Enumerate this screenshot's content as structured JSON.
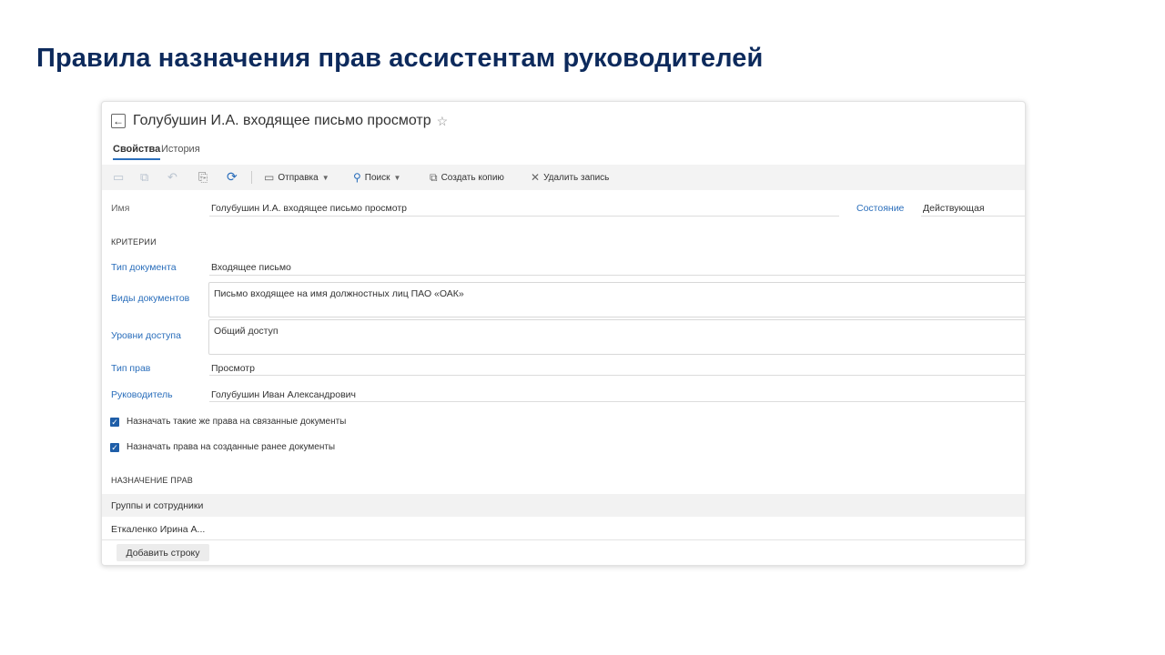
{
  "slide": {
    "title": "Правила назначения прав ассистентам руководителей"
  },
  "record": {
    "title": "Голубушин И.А. входящее письмо просмотр",
    "tabs": [
      {
        "label": "Свойства"
      },
      {
        "label": "История"
      }
    ]
  },
  "toolbar": {
    "send_label": "Отправка",
    "search_label": "Поиск",
    "copy_label": "Создать копию",
    "delete_label": "Удалить запись"
  },
  "form": {
    "name_label": "Имя",
    "name_value": "Голубушин И.А. входящее письмо просмотр",
    "state_label": "Состояние",
    "state_value": "Действующая",
    "criteria_section": "КРИТЕРИИ",
    "doc_type_label": "Тип документа",
    "doc_type_value": "Входящее письмо",
    "doc_kinds_label": "Виды документов",
    "doc_kinds_value": "Письмо входящее на имя должностных лиц ПАО «ОАК»",
    "access_levels_label": "Уровни доступа",
    "access_levels_value": "Общий доступ",
    "rights_type_label": "Тип прав",
    "rights_type_value": "Просмотр",
    "manager_label": "Руководитель",
    "manager_value": "Голубушин Иван Александрович",
    "checkbox_related_label": "Назначать такие же права на связанные документы",
    "checkbox_related_checked": true,
    "checkbox_existing_label": "Назначать права на созданные ранее документы",
    "checkbox_existing_checked": true,
    "assignment_section": "НАЗНАЧЕНИЕ ПРАВ"
  },
  "grid": {
    "column_header": "Группы и сотрудники",
    "rows": [
      {
        "value": "Еткаленко Ирина А..."
      }
    ],
    "add_row_label": "Добавить строку"
  },
  "colors": {
    "title": "#0d2a5c",
    "link": "#2a6ebb",
    "checkbox": "#1f5ea8"
  },
  "icons": [
    "back-arrow-icon",
    "star-icon",
    "save-icon",
    "save-close-icon",
    "undo-icon",
    "copy-icon",
    "refresh-icon",
    "send-icon",
    "search-icon",
    "chevron-down-icon",
    "create-copy-icon",
    "close-icon",
    "checkmark-icon"
  ]
}
